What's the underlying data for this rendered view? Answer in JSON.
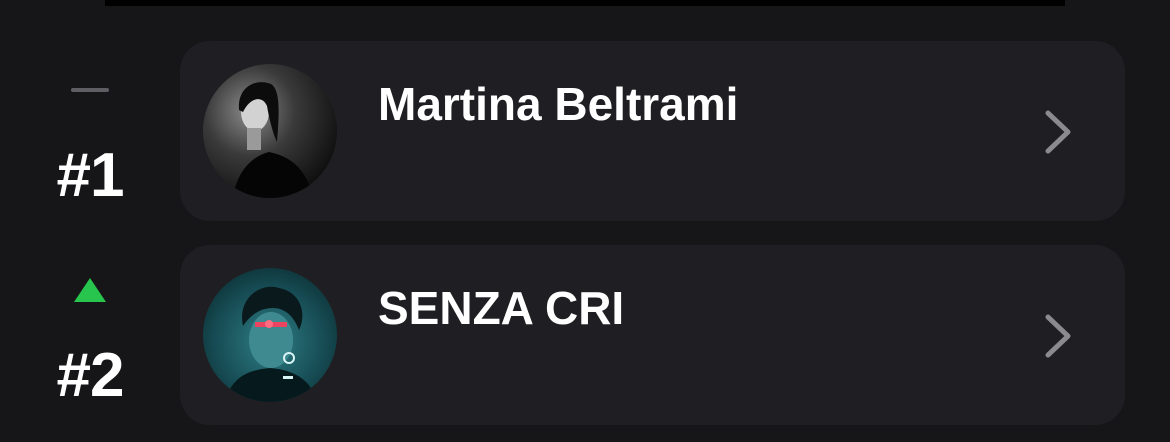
{
  "chart_rows": [
    {
      "trend": "no-change",
      "rank": "#1",
      "artist": "Martina Beltrami",
      "avatar_icon": "artist-photo-monochrome"
    },
    {
      "trend": "up",
      "trend_color": "#27c44e",
      "rank": "#2",
      "artist": "SENZA CRI",
      "avatar_icon": "artist-photo-teal"
    }
  ],
  "colors": {
    "background": "#161618",
    "card": "#1f1f23",
    "trend_up": "#27c44e",
    "trend_flat": "#5e5e63",
    "chevron": "#8a8a8f"
  }
}
